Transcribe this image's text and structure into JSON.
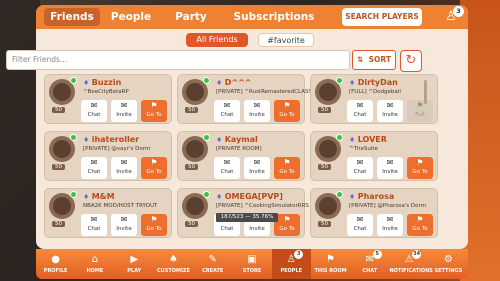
{
  "tabs": [
    {
      "label": "Friends",
      "active": true
    },
    {
      "label": "People",
      "active": false
    },
    {
      "label": "Party",
      "active": false
    },
    {
      "label": "Subscriptions",
      "active": false
    }
  ],
  "search_players_label": "SEARCH PLAYERS",
  "friend_requests_badge": "3",
  "filters": [
    {
      "label": "All Friends",
      "active": true
    },
    {
      "label": "#favorite",
      "active": false
    }
  ],
  "filter_placeholder": "Filter Friends...",
  "sort_label": "SORT",
  "friends": [
    {
      "name": "Buzzin",
      "status": "^BeeCityBetaRP",
      "level": "50",
      "online": true,
      "goto_enabled": true
    },
    {
      "name": "D^^^",
      "status": "[PRIVATE] ^RustRemasteredCLASSIC",
      "level": "50",
      "online": true,
      "goto_enabled": true
    },
    {
      "name": "DirtyDan",
      "status": "[FULL] ^Dodgeball",
      "level": "50",
      "online": true,
      "goto_enabled": false
    },
    {
      "name": "ihateroller",
      "status": "[PRIVATE] @vayr's Dorm",
      "level": "50",
      "online": true,
      "goto_enabled": true
    },
    {
      "name": "Kaymal",
      "status": "[PRIVATE ROOM]",
      "level": "50",
      "online": true,
      "goto_enabled": true
    },
    {
      "name": "LOVER",
      "status": "^TheSuite",
      "level": "50",
      "online": true,
      "goto_enabled": true
    },
    {
      "name": "M&M",
      "status": "NBA2K MOD/HOST TRYOUT",
      "level": "50",
      "online": true,
      "goto_enabled": true
    },
    {
      "name": "OMEGA[PVP]",
      "status": "[PRIVATE] ^CookingSimulatorRRS",
      "level": "50",
      "online": true,
      "goto_enabled": true
    },
    {
      "name": "Pharosa",
      "status": "[PRIVATE] @Pharosa's Dorm",
      "level": "50",
      "online": true,
      "goto_enabled": true
    }
  ],
  "actions": {
    "chat": "Chat",
    "invite": "Invite",
    "goto": "Go To",
    "full": "Full"
  },
  "tooltip": "187/523 — 35.76%",
  "nav": [
    {
      "label": "PROFILE",
      "icon": "avatar",
      "badge": ""
    },
    {
      "label": "HOME",
      "icon": "home-icon",
      "badge": ""
    },
    {
      "label": "PLAY",
      "icon": "gamepad-icon",
      "badge": ""
    },
    {
      "label": "CUSTOMIZE",
      "icon": "hanger-icon",
      "badge": ""
    },
    {
      "label": "CREATE",
      "icon": "create-icon",
      "badge": ""
    },
    {
      "label": "STORE",
      "icon": "store-icon",
      "badge": ""
    },
    {
      "label": "PEOPLE",
      "icon": "people-icon",
      "badge": "3",
      "active": true
    },
    {
      "label": "THIS ROOM",
      "icon": "room-icon",
      "badge": ""
    },
    {
      "label": "CHAT",
      "icon": "chat-icon",
      "badge": "5"
    },
    {
      "label": "NOTIFICATIONS",
      "icon": "bell-icon",
      "badge": "34"
    },
    {
      "label": "SETTINGS",
      "icon": "gear-icon",
      "badge": ""
    }
  ],
  "colors": {
    "accent": "#ee8232",
    "panel": "#f6e9dc",
    "goto": "#ee6e2e",
    "online": "#3ac43a"
  }
}
